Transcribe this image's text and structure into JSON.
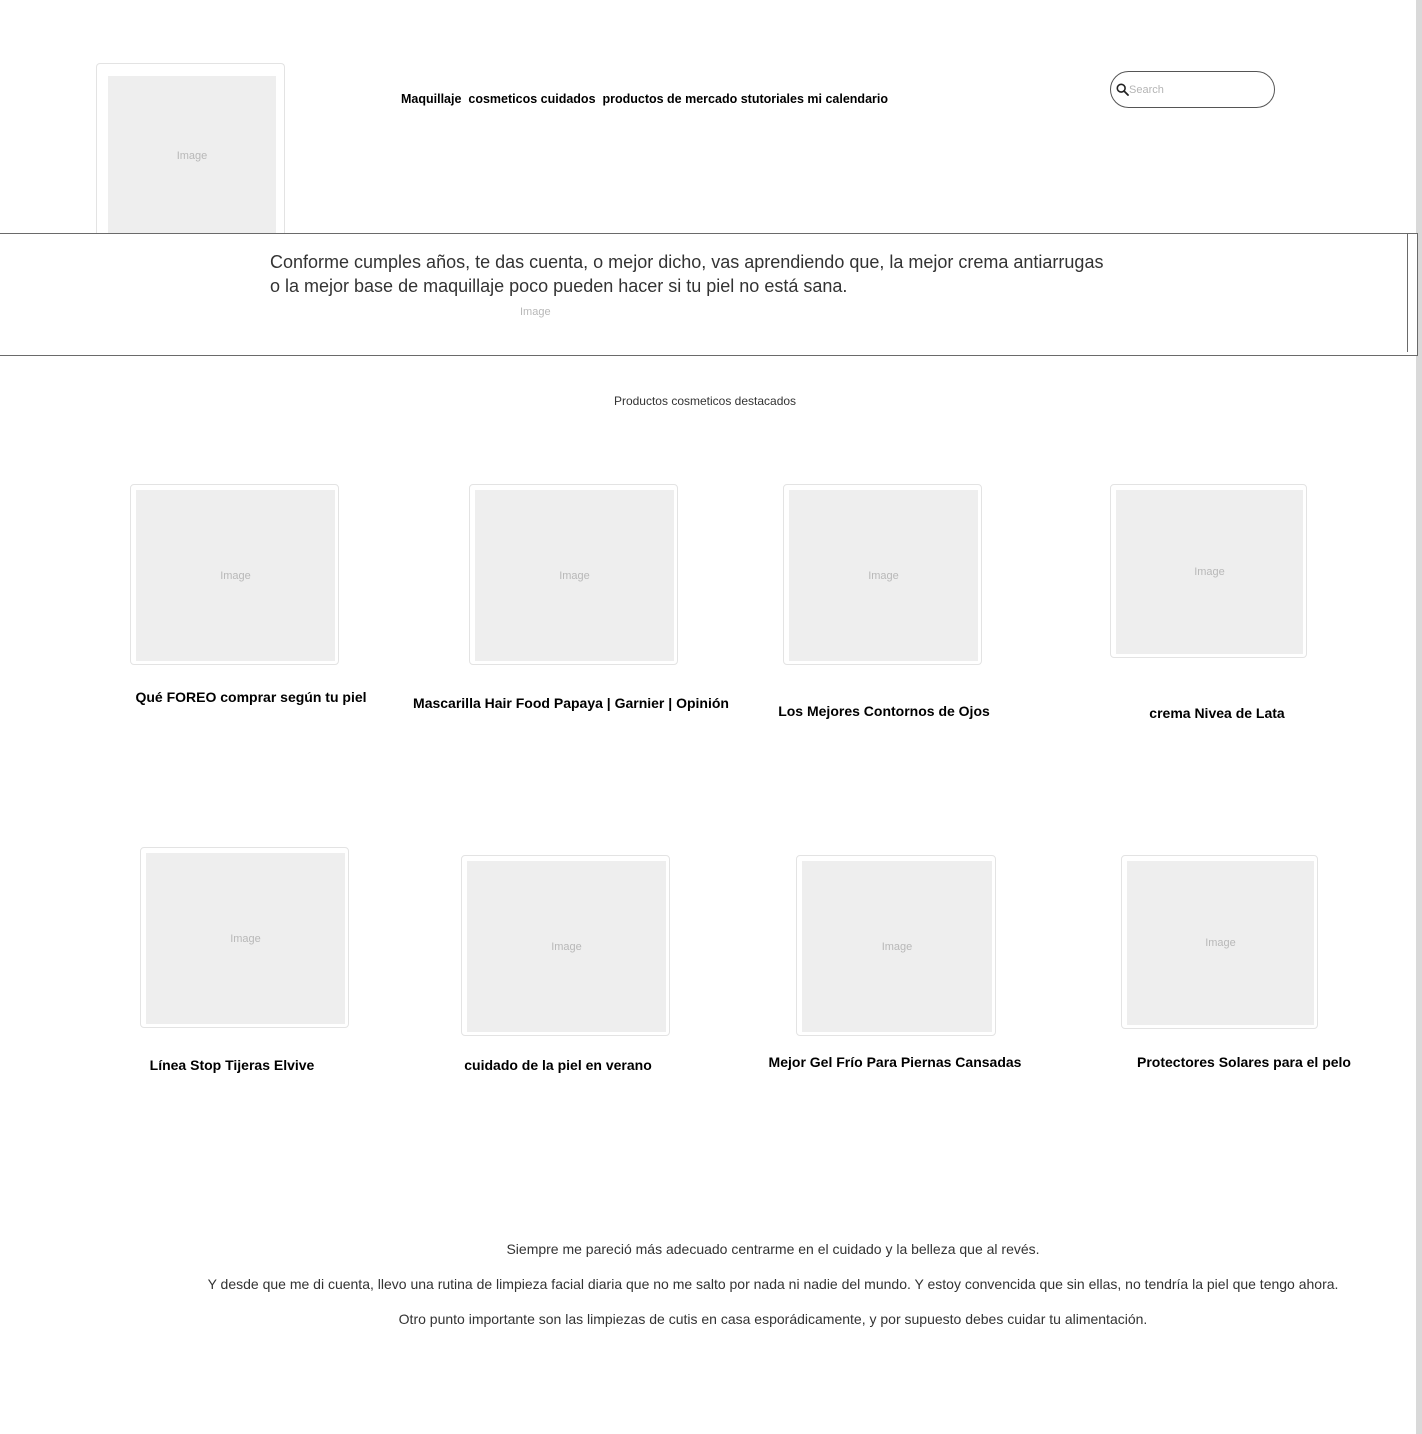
{
  "placeholder_label": "Image",
  "header": {
    "nav": [
      "Maquillaje",
      "cosmeticos cuidados",
      "productos de mercado",
      "stutoriales",
      "mi calendario"
    ],
    "search": {
      "placeholder": "Search",
      "value": ""
    }
  },
  "banner": {
    "line1": "Conforme cumples años, te das cuenta, o mejor dicho, vas aprendiendo que, la mejor crema antiarrugas",
    "line2": "o la mejor base de maquillaje poco pueden hacer si tu piel no está sana."
  },
  "featured": {
    "title": "Productos cosmeticos destacados",
    "products": [
      "Qué FOREO comprar según tu piel",
      "Mascarilla Hair Food Papaya | Garnier | Opinión",
      "Los Mejores Contornos de Ojos",
      "crema Nivea de Lata",
      "Línea Stop Tijeras Elvive",
      "cuidado de la piel en verano",
      "Mejor Gel Frío Para Piernas Cansadas",
      "Protectores Solares para el pelo"
    ]
  },
  "footer": {
    "paragraphs": [
      "Siempre me pareció más adecuado centrarme en el cuidado y la belleza que al revés.",
      "Y desde que me di cuenta, llevo una rutina de limpieza facial diaria que no me salto por nada ni nadie del mundo. Y estoy convencida que sin ellas, no tendría la piel que tengo ahora.",
      "Otro punto importante son las limpiezas de cutis en casa esporádicamente, y por supuesto debes cuidar tu alimentación."
    ]
  }
}
